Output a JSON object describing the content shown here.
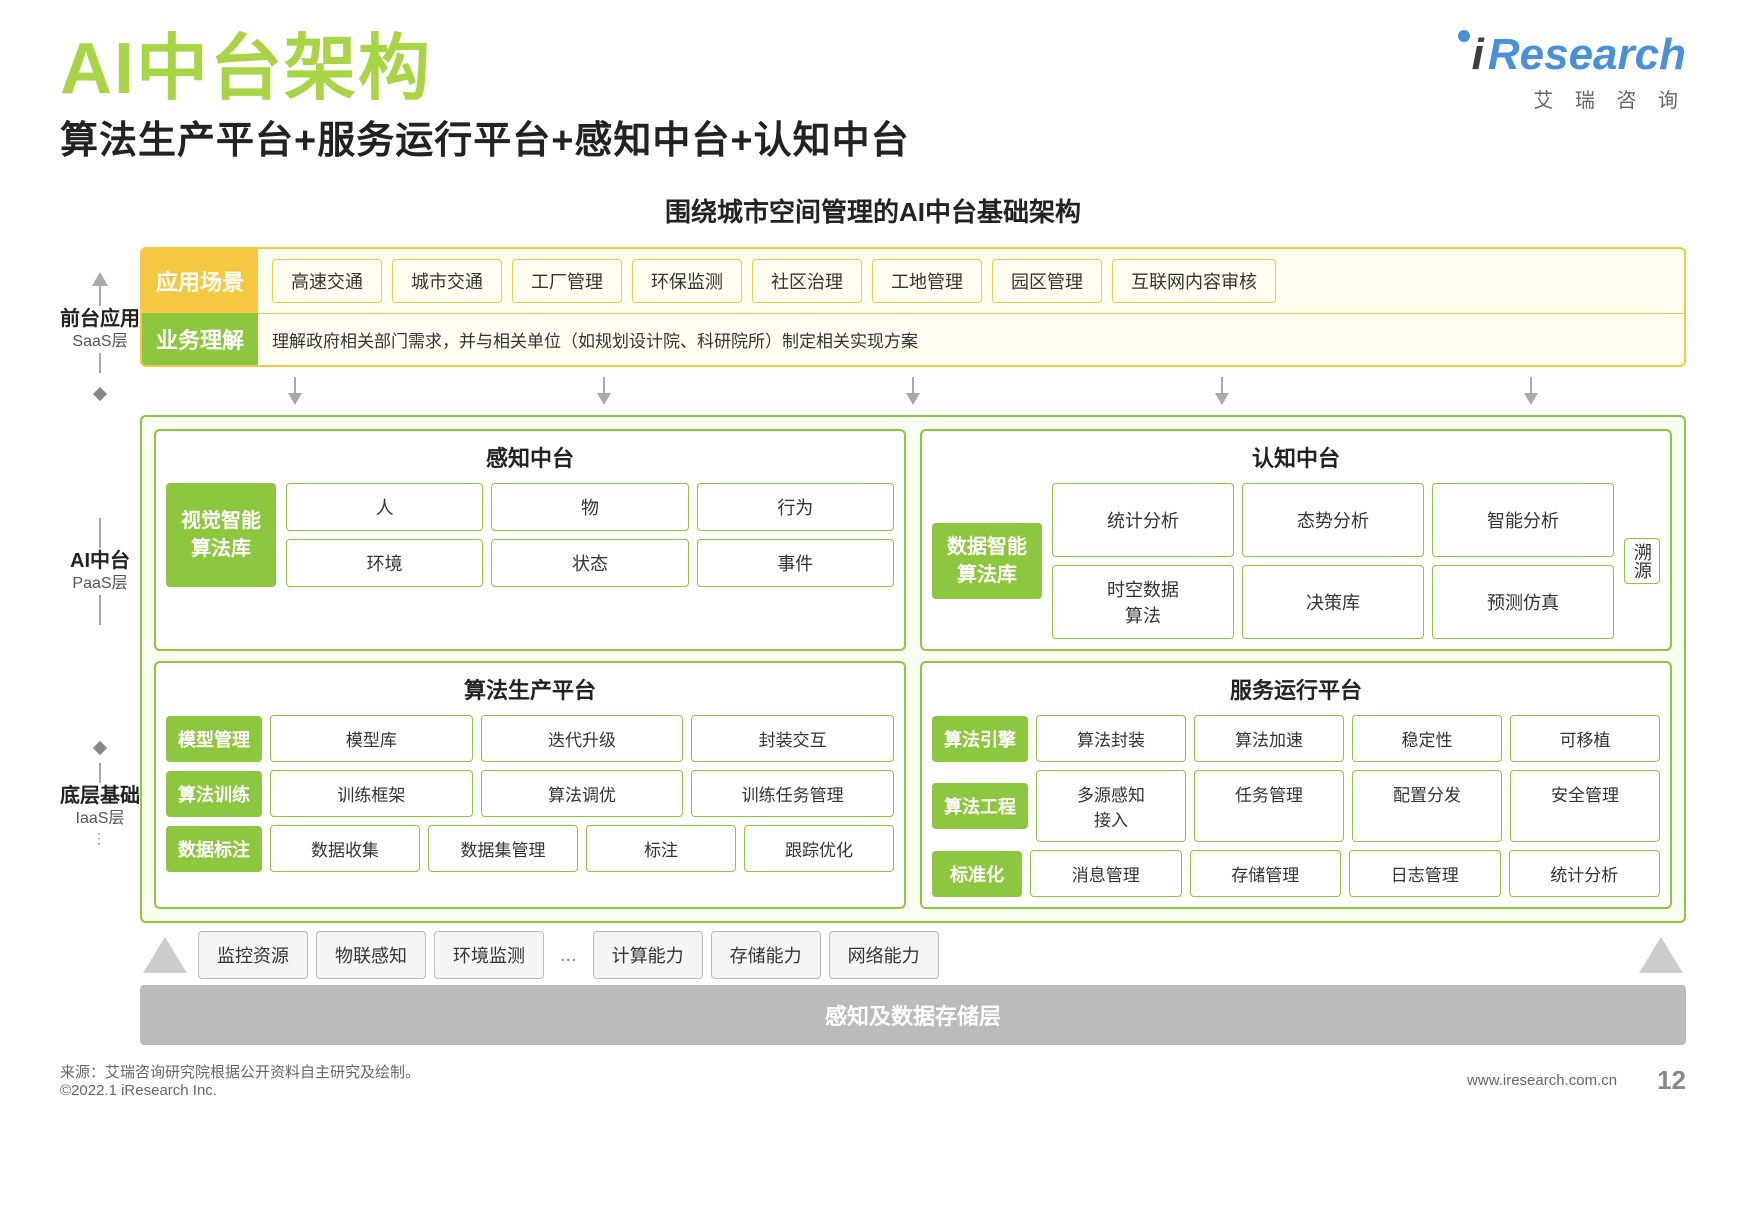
{
  "header": {
    "main_title": "AI中台架构",
    "subtitle": "算法生产平台+服务运行平台+感知中台+认知中台",
    "diagram_title": "围绕城市空间管理的AI中台基础架构",
    "logo_i": "i",
    "logo_research": "Research",
    "logo_chinese": "艾  瑞  咨  询"
  },
  "left_axis": {
    "saas_label1": "前台应用",
    "saas_label2": "SaaS层",
    "paas_label1": "AI中台",
    "paas_label2": "PaaS层",
    "iaas_label1": "底层基础",
    "iaas_label2": "IaaS层"
  },
  "saas": {
    "apps_label": "应用场景",
    "business_label": "业务理解",
    "business_desc": "理解政府相关部门需求，并与相关单位（如规划设计院、科研院所）制定相关实现方案",
    "apps": [
      "高速交通",
      "城市交通",
      "工厂管理",
      "环保监测",
      "社区治理",
      "工地管理",
      "园区管理",
      "互联网内容审核"
    ]
  },
  "sensing": {
    "title": "感知中台",
    "algo_label": "视觉智能\n算法库",
    "cells_row1": [
      "人",
      "物",
      "行为"
    ],
    "cells_row2": [
      "环境",
      "状态",
      "事件"
    ]
  },
  "cognition": {
    "title": "认知中台",
    "algo_label": "数据智能\n算法库",
    "cells_row1": [
      "统计分析",
      "态势分析",
      "智能分析"
    ],
    "cells_row2": [
      "时空数据\n算法",
      "决策库",
      "预测仿真"
    ],
    "source_label": "溯源"
  },
  "algo_platform": {
    "title": "算法生产平台",
    "rows": [
      {
        "label": "模型管理",
        "cells": [
          "模型库",
          "迭代升级",
          "封装交互"
        ]
      },
      {
        "label": "算法训练",
        "cells": [
          "训练框架",
          "算法调优",
          "训练任务管理"
        ]
      },
      {
        "label": "数据标注",
        "cells": [
          "数据收集",
          "数据集管理",
          "标注",
          "跟踪优化"
        ]
      }
    ]
  },
  "service_platform": {
    "title": "服务运行平台",
    "rows": [
      {
        "label": "算法引擎",
        "cells": [
          "算法封装",
          "算法加速",
          "稳定性",
          "可移植"
        ]
      },
      {
        "label": "算法工程",
        "cells": [
          "多源感知\n接入",
          "任务管理",
          "配置分发",
          "安全管理"
        ]
      },
      {
        "label": "标准化",
        "cells": [
          "消息管理",
          "存储管理",
          "日志管理",
          "统计分析"
        ]
      }
    ]
  },
  "iaas": {
    "cells": [
      "监控资源",
      "物联感知",
      "环境监测",
      "...",
      "计算能力",
      "存储能力",
      "网络能力"
    ],
    "bottom_label": "感知及数据存储层"
  },
  "footer": {
    "source": "来源：艾瑞咨询研究院根据公开资料自主研究及绘制。",
    "copyright": "©2022.1 iResearch Inc.",
    "website": "www.iresearch.com.cn",
    "page_num": "12"
  }
}
